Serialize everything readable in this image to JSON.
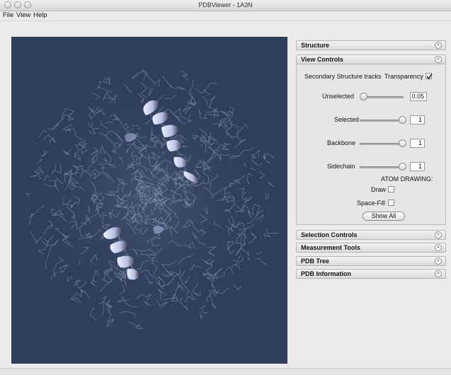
{
  "window": {
    "title": "PDBViewer - 1A3N"
  },
  "menubar": {
    "items": [
      "File",
      "View",
      "Help"
    ]
  },
  "panel": {
    "sections": [
      {
        "label": "Structure",
        "expanded": false
      },
      {
        "label": "View Controls",
        "expanded": true
      },
      {
        "label": "Selection Controls",
        "expanded": false
      },
      {
        "label": "Measurement Tools",
        "expanded": false
      },
      {
        "label": "PDB Tree",
        "expanded": false
      },
      {
        "label": "PDB Information",
        "expanded": false
      }
    ],
    "view_controls": {
      "secondary_label": "Secondary Structure tracks",
      "transparency_label": "Transparency",
      "transparency_checked": true,
      "sliders": [
        {
          "label": "Unselected",
          "value": "0.05",
          "fraction": 0.05
        },
        {
          "label": "Selected",
          "value": "1",
          "fraction": 1
        },
        {
          "label": "Backbone",
          "value": "1",
          "fraction": 1
        },
        {
          "label": "Sidechain",
          "value": "1",
          "fraction": 1
        }
      ],
      "atom_drawing_label": "ATOM DRAWING:",
      "draw_label": "Draw",
      "draw_checked": false,
      "spacefill_label": "Space-Fill",
      "spacefill_checked": false,
      "show_all_label": "Show All"
    }
  },
  "colors": {
    "viewer_bg": "#2e3e5c",
    "ribbon": "#c8d0ff",
    "wire": "#b8c2d8"
  },
  "icons": {
    "collapsed": "double-chevron-down-icon",
    "expanded": "double-chevron-up-icon"
  }
}
